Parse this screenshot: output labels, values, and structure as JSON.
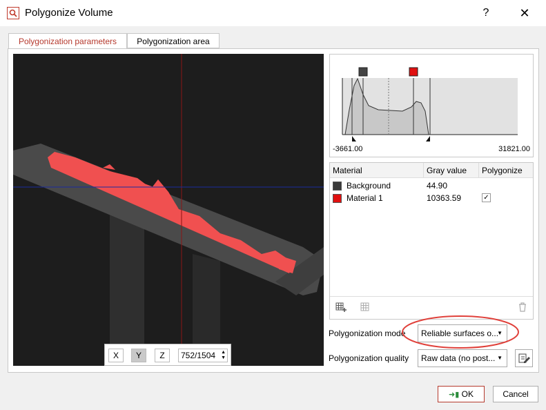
{
  "window": {
    "title": "Polygonize Volume",
    "help_label": "?",
    "close_label": "✕"
  },
  "tabs": [
    {
      "label": "Polygonization parameters",
      "active": true
    },
    {
      "label": "Polygonization area",
      "active": false
    }
  ],
  "slice_controls": {
    "x_label": "X",
    "y_label": "Y",
    "z_label": "Z",
    "selected_axis": "Y",
    "slice_value": "752/1504"
  },
  "histogram": {
    "min_label": "-3661.00",
    "max_label": "31821.00",
    "marker_colors": [
      "#444444",
      "#e01010"
    ]
  },
  "materials_table": {
    "headers": {
      "material": "Material",
      "gray": "Gray value",
      "polygonize": "Polygonize"
    },
    "rows": [
      {
        "name": "Background",
        "color": "#3a3a3a",
        "gray": "44.90",
        "checked": false
      },
      {
        "name": "Material 1",
        "color": "#e01010",
        "gray": "10363.59",
        "checked": true
      }
    ]
  },
  "mode": {
    "label": "Polygonization mode",
    "value": "Reliable surfaces o..."
  },
  "quality": {
    "label": "Polygonization quality",
    "value": "Raw data (no post..."
  },
  "buttons": {
    "ok_label": "OK",
    "cancel_label": "Cancel"
  },
  "colors": {
    "accent": "#b5382c",
    "highlight_ellipse": "#e0403a",
    "material_red": "#f05050"
  }
}
